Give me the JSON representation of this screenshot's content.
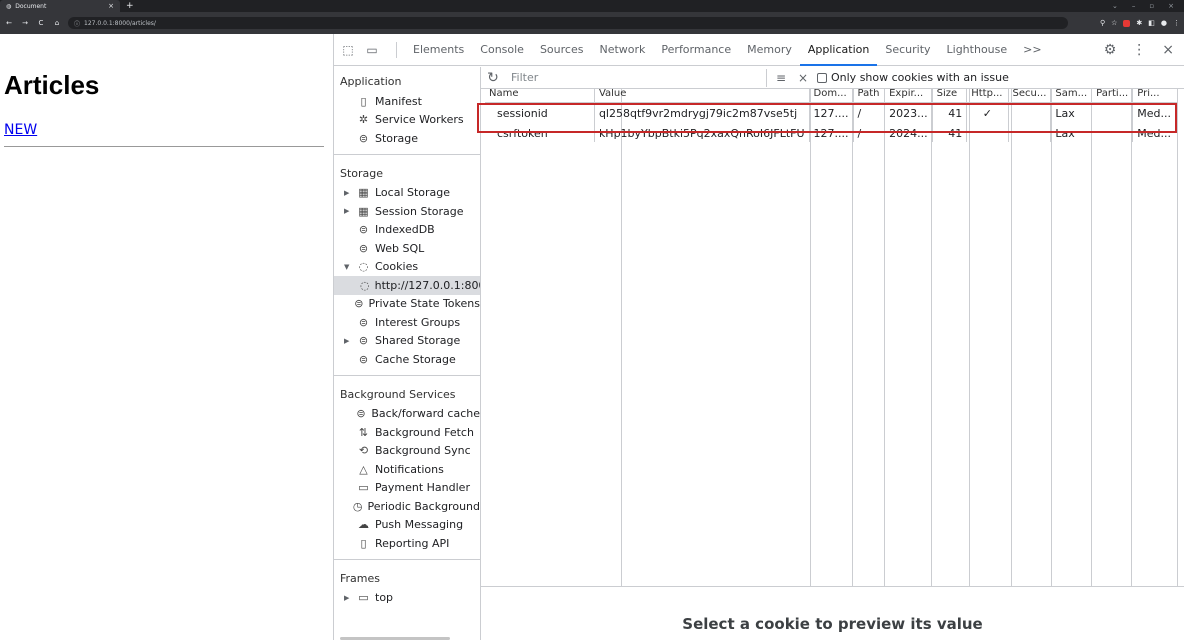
{
  "browser": {
    "tab_title": "Document",
    "url": "127.0.0.1:8000/articles/"
  },
  "page": {
    "heading": "Articles",
    "new_link": "NEW"
  },
  "devtools": {
    "tabs": [
      "Elements",
      "Console",
      "Sources",
      "Network",
      "Performance",
      "Memory",
      "Application",
      "Security",
      "Lighthouse"
    ],
    "active_tab": "Application",
    "more_tabs": ">>",
    "sidebar": {
      "application_title": "Application",
      "application_items": [
        {
          "label": "Manifest",
          "icon": "document-icon"
        },
        {
          "label": "Service Workers",
          "icon": "gears-icon"
        },
        {
          "label": "Storage",
          "icon": "database-icon"
        }
      ],
      "storage_title": "Storage",
      "storage_items": [
        {
          "label": "Local Storage",
          "icon": "grid-icon",
          "expandable": true
        },
        {
          "label": "Session Storage",
          "icon": "grid-icon",
          "expandable": true
        },
        {
          "label": "IndexedDB",
          "icon": "database-icon"
        },
        {
          "label": "Web SQL",
          "icon": "database-icon"
        },
        {
          "label": "Cookies",
          "icon": "cookie-icon",
          "expanded": true
        },
        {
          "label": "http://127.0.0.1:800",
          "icon": "cookie-icon",
          "sub": true,
          "selected": true
        },
        {
          "label": "Private State Tokens",
          "icon": "database-icon"
        },
        {
          "label": "Interest Groups",
          "icon": "database-icon"
        },
        {
          "label": "Shared Storage",
          "icon": "database-icon",
          "expandable": true
        },
        {
          "label": "Cache Storage",
          "icon": "database-icon"
        }
      ],
      "background_title": "Background Services",
      "background_items": [
        {
          "label": "Back/forward cache",
          "icon": "database-icon"
        },
        {
          "label": "Background Fetch",
          "icon": "updown-arrows-icon"
        },
        {
          "label": "Background Sync",
          "icon": "sync-icon"
        },
        {
          "label": "Notifications",
          "icon": "bell-icon"
        },
        {
          "label": "Payment Handler",
          "icon": "card-icon"
        },
        {
          "label": "Periodic Background",
          "icon": "clock-icon"
        },
        {
          "label": "Push Messaging",
          "icon": "cloud-icon"
        },
        {
          "label": "Reporting API",
          "icon": "document-icon"
        }
      ],
      "frames_title": "Frames",
      "frames_items": [
        {
          "label": "top",
          "icon": "frame-icon",
          "expandable": true
        }
      ]
    },
    "toolbar": {
      "filter_placeholder": "Filter",
      "only_issues_label": "Only show cookies with an issue"
    },
    "columns": [
      "Name",
      "Value",
      "Dom...",
      "Path",
      "Expir...",
      "Size",
      "Http...",
      "Secu...",
      "Sam...",
      "Parti...",
      "Pri..."
    ],
    "cookies": [
      {
        "name": "sessionid",
        "value": "ql258qtf9vr2mdrygj79ic2m87vse5tj",
        "domain": "127....",
        "path": "/",
        "expires": "2023...",
        "size": "41",
        "http": "✓",
        "secure": "",
        "samesite": "Lax",
        "partition": "",
        "priority": "Med..."
      },
      {
        "name": "csrftoken",
        "value": "kHp1byYbpBtki5Pq2xaxQnRoI6JFLtFU",
        "domain": "127....",
        "path": "/",
        "expires": "2024...",
        "size": "41",
        "http": "",
        "secure": "",
        "samesite": "Lax",
        "partition": "",
        "priority": "Med..."
      }
    ],
    "preview_message": "Select a cookie to preview its value"
  }
}
